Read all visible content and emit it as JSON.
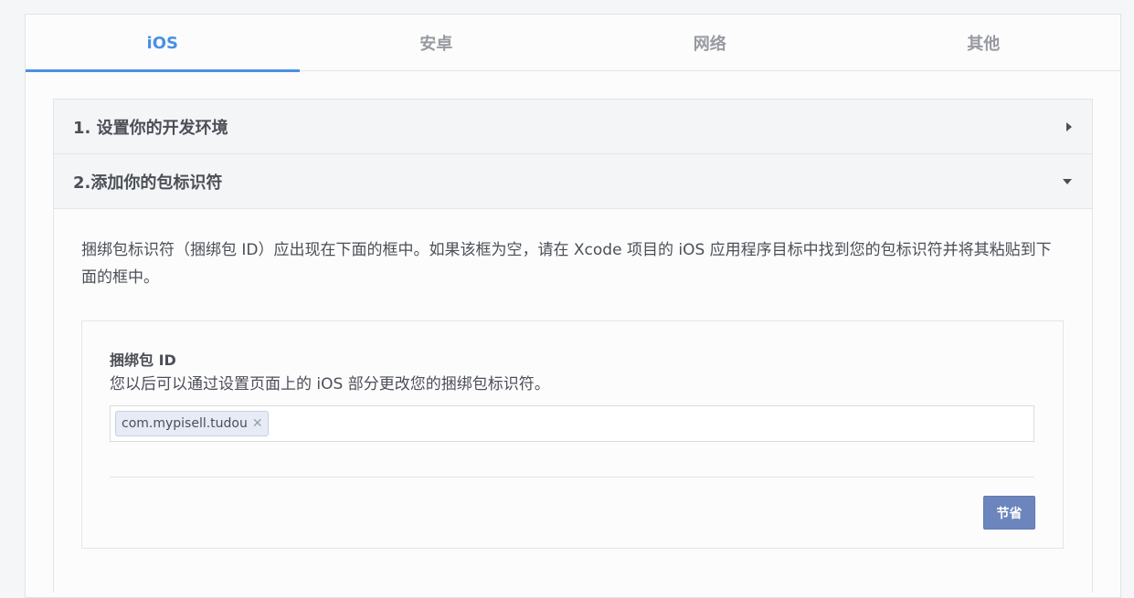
{
  "tabs": [
    {
      "label": "iOS",
      "active": true
    },
    {
      "label": "安卓",
      "active": false
    },
    {
      "label": "网络",
      "active": false
    },
    {
      "label": "其他",
      "active": false
    }
  ],
  "accordion": {
    "section1": {
      "title": "1. 设置你的开发环境",
      "state": "collapsed",
      "icon": "caret-right-icon"
    },
    "section2": {
      "title": "2.添加你的包标识符",
      "state": "expanded",
      "icon": "caret-down-icon"
    }
  },
  "body": {
    "description": "捆绑包标识符（捆绑包 ID）应出现在下面的框中。如果该框为空，请在 Xcode 项目的 iOS 应用程序目标中找到您的包标识符并将其粘贴到下面的框中。",
    "field_label": "捆绑包 ID",
    "field_help": "您以后可以通过设置页面上的 iOS 部分更改您的捆绑包标识符。",
    "tokens": [
      "com.mypisell.tudou"
    ],
    "token_remove_glyph": "✕",
    "save_label": "节省"
  },
  "colors": {
    "accent": "#4a90e2",
    "button": "#6c86bd",
    "token_bg": "#e6ebf5"
  }
}
